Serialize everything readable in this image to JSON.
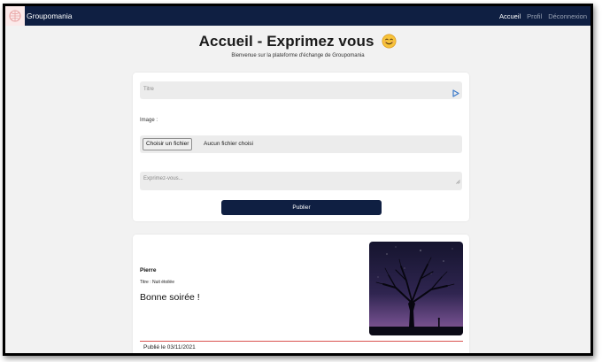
{
  "navbar": {
    "brand": "Groupomania",
    "links": [
      {
        "label": "Accueil",
        "active": true
      },
      {
        "label": "Profil",
        "active": false
      },
      {
        "label": "Déconnexion",
        "active": false
      }
    ],
    "background": "#0f1f42"
  },
  "header": {
    "title": "Accueil - Exprimez vous",
    "subtitle": "Bienvenue sur la plateforme d'échange de Groupomania"
  },
  "form": {
    "title_placeholder": "Titre",
    "image_label": "Image :",
    "file_button": "Choisir un fichier",
    "file_status": "Aucun fichier choisi",
    "text_placeholder": "Exprimez-vous...",
    "submit_label": "Publier"
  },
  "post": {
    "author": "Pierre",
    "title": "Titre : Nuit étoilée",
    "body": "Bonne soirée !",
    "date": "Publié le 03/11/2021",
    "divider_color": "#d9534f"
  }
}
